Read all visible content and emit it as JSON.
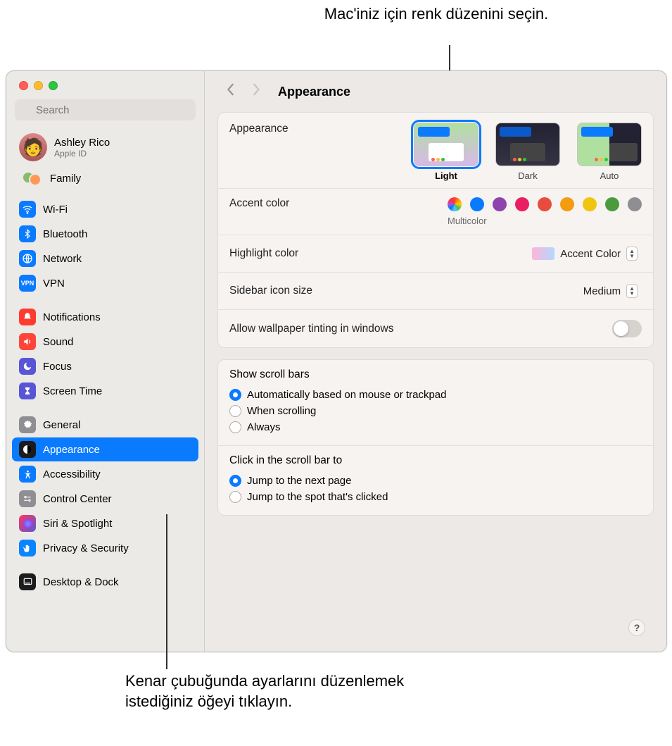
{
  "callouts": {
    "top": "Mac'iniz için renk düzenini seçin.",
    "bottom": "Kenar çubuğunda ayarlarını düzenlemek istediğiniz öğeyi tıklayın."
  },
  "window": {
    "search_placeholder": "Search",
    "title": "Appearance"
  },
  "account": {
    "name": "Ashley Rico",
    "sub": "Apple ID",
    "family": "Family"
  },
  "sidebar_groups": [
    [
      {
        "id": "wifi",
        "label": "Wi-Fi",
        "icon": "wifi",
        "bg": "bg-blue"
      },
      {
        "id": "bluetooth",
        "label": "Bluetooth",
        "icon": "bt",
        "bg": "bg-blue"
      },
      {
        "id": "network",
        "label": "Network",
        "icon": "net",
        "bg": "bg-blue"
      },
      {
        "id": "vpn",
        "label": "VPN",
        "icon": "vpn",
        "bg": "bg-blue"
      }
    ],
    [
      {
        "id": "notifications",
        "label": "Notifications",
        "icon": "bell",
        "bg": "bg-red"
      },
      {
        "id": "sound",
        "label": "Sound",
        "icon": "sound",
        "bg": "bg-red2"
      },
      {
        "id": "focus",
        "label": "Focus",
        "icon": "moon",
        "bg": "bg-purple"
      },
      {
        "id": "screentime",
        "label": "Screen Time",
        "icon": "hourglass",
        "bg": "bg-purple"
      }
    ],
    [
      {
        "id": "general",
        "label": "General",
        "icon": "gear",
        "bg": "bg-gray"
      },
      {
        "id": "appearance",
        "label": "Appearance",
        "icon": "appearance",
        "bg": "bg-dark",
        "selected": true
      },
      {
        "id": "accessibility",
        "label": "Accessibility",
        "icon": "access",
        "bg": "bg-blue"
      },
      {
        "id": "controlcenter",
        "label": "Control Center",
        "icon": "cc",
        "bg": "bg-gray"
      },
      {
        "id": "siri",
        "label": "Siri & Spotlight",
        "icon": "siri",
        "bg": "bg-gradient"
      },
      {
        "id": "privacy",
        "label": "Privacy & Security",
        "icon": "hand",
        "bg": "bg-bluedark"
      }
    ],
    [
      {
        "id": "desktop",
        "label": "Desktop & Dock",
        "icon": "dock",
        "bg": "bg-dark"
      }
    ]
  ],
  "panel": {
    "appearance": {
      "label": "Appearance",
      "options": [
        {
          "id": "light",
          "label": "Light",
          "thumb": "thumb-light",
          "selected": true
        },
        {
          "id": "dark",
          "label": "Dark",
          "thumb": "thumb-dark"
        },
        {
          "id": "auto",
          "label": "Auto",
          "thumb": "thumb-auto"
        }
      ]
    },
    "accent": {
      "label": "Accent color",
      "selected_label": "Multicolor",
      "colors": [
        "multi",
        "blue",
        "purple",
        "pink",
        "red",
        "orange",
        "yellow",
        "green",
        "gray"
      ]
    },
    "highlight": {
      "label": "Highlight color",
      "value": "Accent Color"
    },
    "sidebar_icon": {
      "label": "Sidebar icon size",
      "value": "Medium"
    },
    "tinting": {
      "label": "Allow wallpaper tinting in windows",
      "on": false
    },
    "scrollbars": {
      "label": "Show scroll bars",
      "options": [
        {
          "id": "auto",
          "label": "Automatically based on mouse or trackpad",
          "checked": true
        },
        {
          "id": "scrolling",
          "label": "When scrolling"
        },
        {
          "id": "always",
          "label": "Always"
        }
      ]
    },
    "click_scroll": {
      "label": "Click in the scroll bar to",
      "options": [
        {
          "id": "next",
          "label": "Jump to the next page",
          "checked": true
        },
        {
          "id": "spot",
          "label": "Jump to the spot that's clicked"
        }
      ]
    }
  },
  "help_glyph": "?"
}
